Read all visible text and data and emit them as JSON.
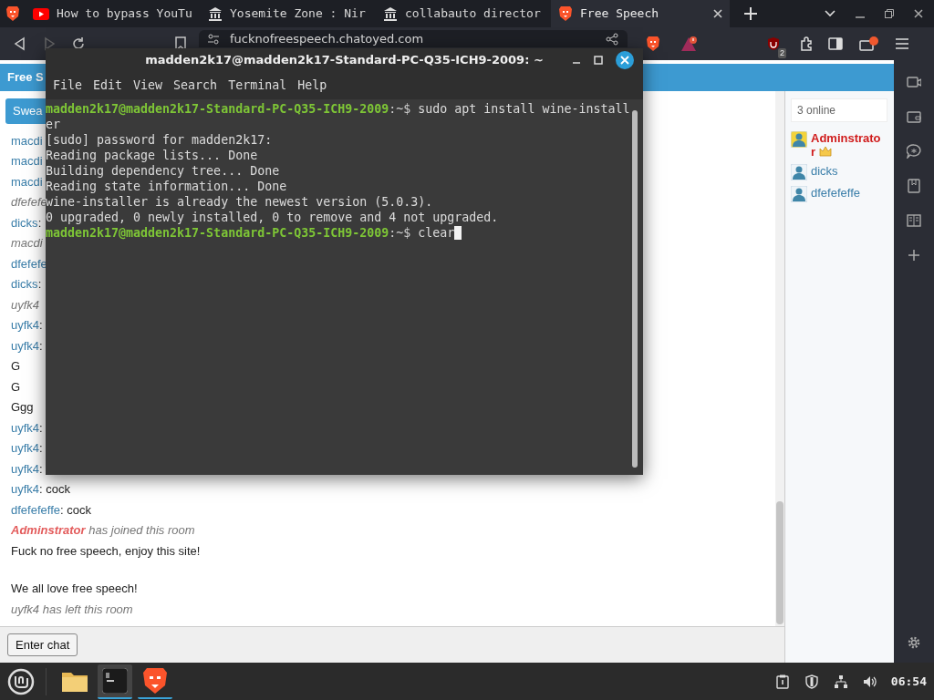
{
  "browser": {
    "tabs": [
      {
        "title": "How to bypass YouTu",
        "selected": false
      },
      {
        "title": "Yosemite Zone : Nir",
        "selected": false
      },
      {
        "title": "collabauto director",
        "selected": false
      },
      {
        "title": "Free Speech",
        "selected": true
      }
    ],
    "url": "fucknofreespeech.chatoyed.com",
    "blocked_count": "2"
  },
  "chat_page": {
    "header": "Free S",
    "swear_button": "Swea",
    "messages": [
      {
        "kind": "user",
        "name": "macdi"
      },
      {
        "kind": "user",
        "name": "macdi"
      },
      {
        "kind": "user",
        "name": "macdi"
      },
      {
        "kind": "system",
        "text": "dfefefe"
      },
      {
        "kind": "user",
        "name": "dicks",
        "text": ":"
      },
      {
        "kind": "system",
        "text": "macdi"
      },
      {
        "kind": "user",
        "name": "dfefefe"
      },
      {
        "kind": "user",
        "name": "dicks",
        "text": ":"
      },
      {
        "kind": "system",
        "text": "uyfk4"
      },
      {
        "kind": "user",
        "name": "uyfk4",
        "text": ":"
      },
      {
        "kind": "user",
        "name": "uyfk4",
        "text": ":"
      },
      {
        "kind": "plain",
        "text": "G"
      },
      {
        "kind": "plain",
        "text": "G"
      },
      {
        "kind": "plain",
        "text": "Ggg"
      },
      {
        "kind": "user",
        "name": "uyfk4",
        "text": ":"
      },
      {
        "kind": "user",
        "name": "uyfk4",
        "text": ":"
      },
      {
        "kind": "user",
        "name": "uyfk4",
        "text": ":"
      },
      {
        "kind": "user",
        "name": "uyfk4",
        "text": ": cock"
      },
      {
        "kind": "user",
        "name": "dfefefeffe",
        "text": ": cock"
      },
      {
        "kind": "join",
        "name": "Adminstrator",
        "admin": true,
        "text": " has joined this room"
      },
      {
        "kind": "announcement",
        "paragraphs": [
          "Fuck no free speech, enjoy this site!",
          "We all love free speech!"
        ]
      },
      {
        "kind": "system",
        "text": "uyfk4 has left this room"
      }
    ],
    "online_filter": {
      "placeholder": "3 online"
    },
    "users": [
      {
        "name": "Adminstrator",
        "admin": true
      },
      {
        "name": "dicks",
        "admin": false
      },
      {
        "name": "dfefefeffe",
        "admin": false
      }
    ],
    "enter_button": "Enter chat"
  },
  "terminal": {
    "title": "madden2k17@madden2k17-Standard-PC-Q35-ICH9-2009: ~",
    "menu": [
      "File",
      "Edit",
      "View",
      "Search",
      "Terminal",
      "Help"
    ],
    "lines": [
      {
        "kind": "prompt",
        "user_host": "madden2k17@madden2k17-Standard-PC-Q35-ICH9-2009",
        "path": ":~$",
        "command": "sudo apt install wine-installer",
        "cursor": false
      },
      {
        "kind": "output",
        "text": "[sudo] password for madden2k17:",
        "cursor": false
      },
      {
        "kind": "output",
        "text": "Reading package lists... Done",
        "cursor": false
      },
      {
        "kind": "output",
        "text": "Building dependency tree... Done",
        "cursor": false
      },
      {
        "kind": "output",
        "text": "Reading state information... Done",
        "cursor": false
      },
      {
        "kind": "output",
        "text": "wine-installer is already the newest version (5.0.3).",
        "cursor": false
      },
      {
        "kind": "output",
        "text": "0 upgraded, 0 newly installed, 0 to remove and 4 not upgraded.",
        "cursor": false
      },
      {
        "kind": "prompt",
        "user_host": "madden2k17@madden2k17-Standard-PC-Q35-ICH9-2009",
        "path": ":~$",
        "command": "clear",
        "cursor": true
      }
    ]
  },
  "taskbar": {
    "apps": [
      {
        "running": false
      },
      {
        "running": true
      },
      {
        "running": true
      }
    ],
    "clock": "06:54"
  }
}
